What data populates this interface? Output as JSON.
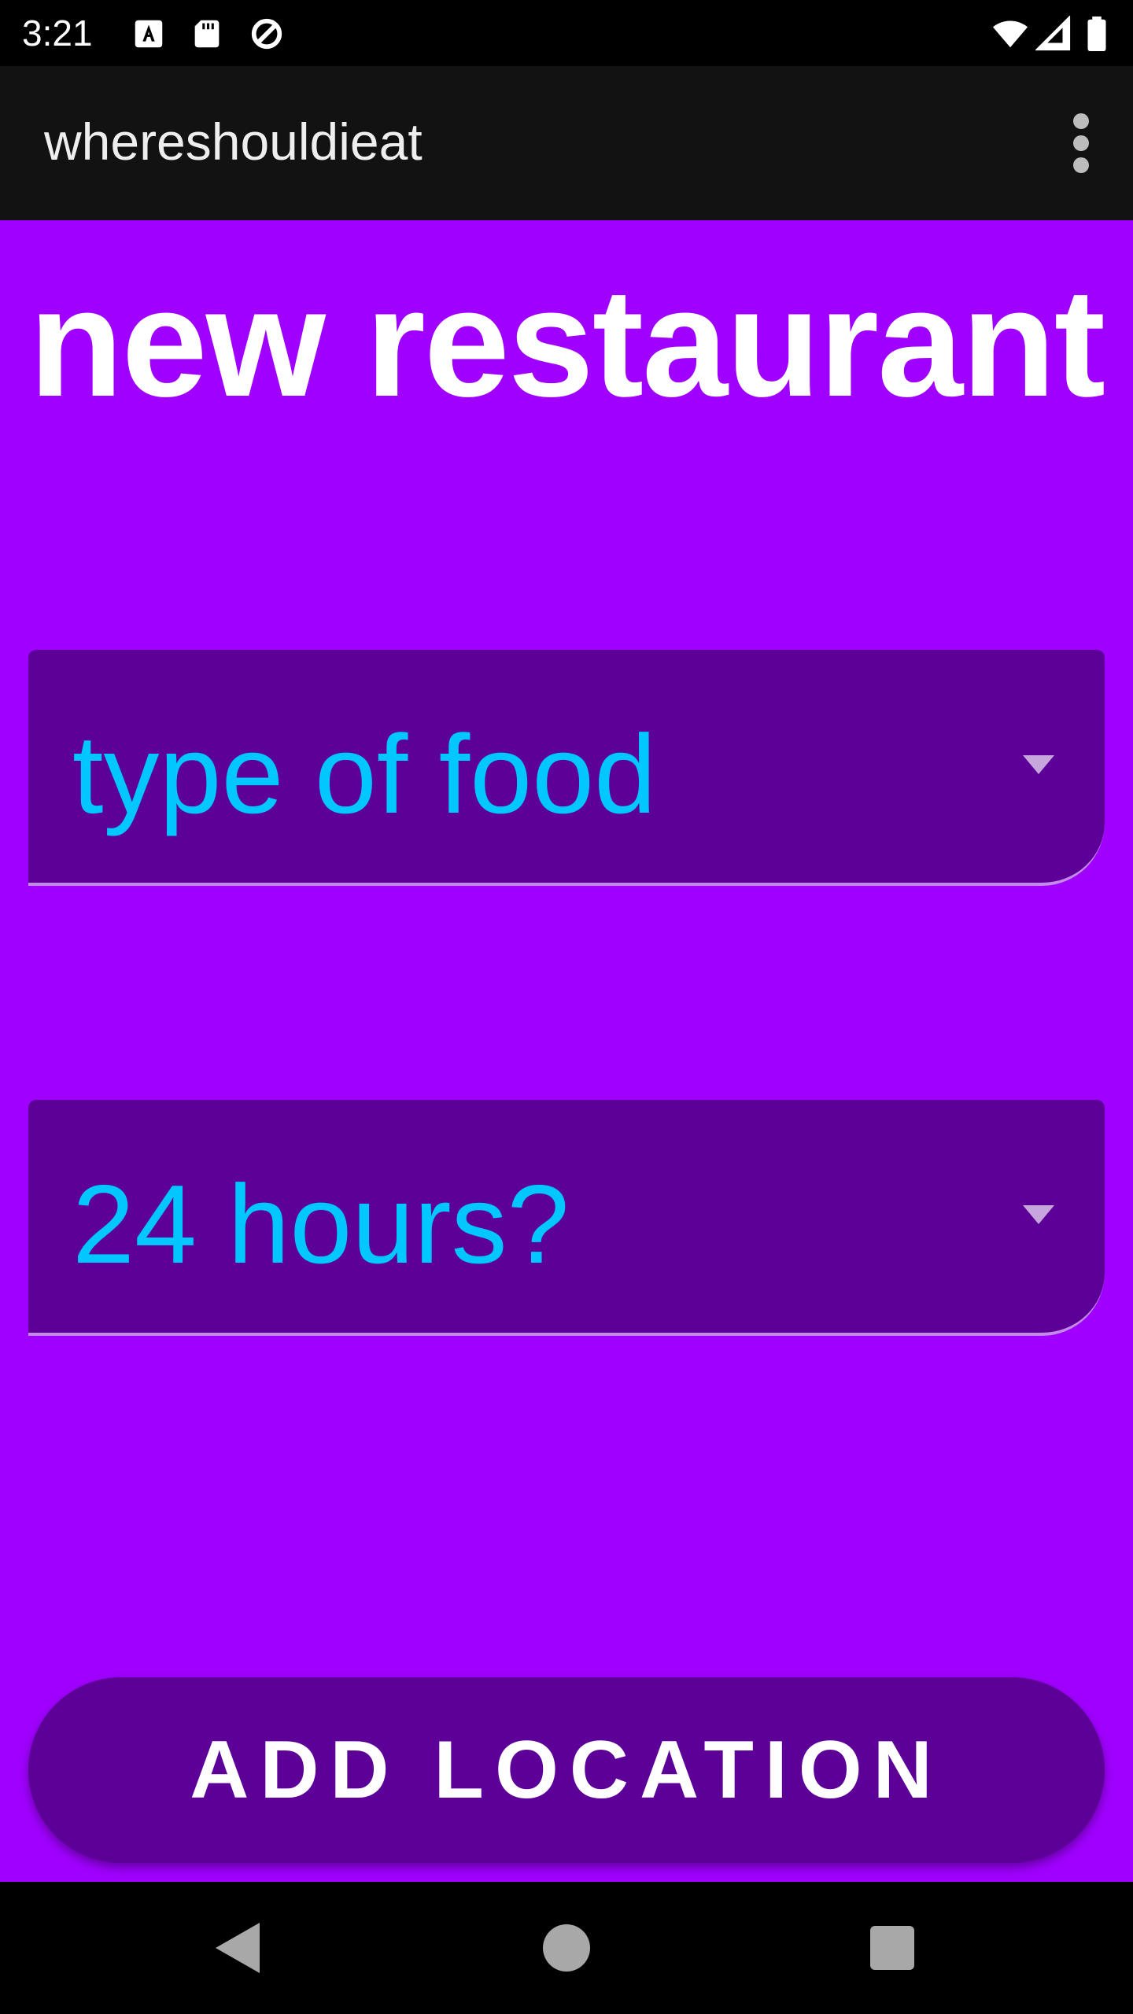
{
  "status_bar": {
    "time": "3:21",
    "icons": [
      "accessibility-a-icon",
      "sd-card-icon",
      "data-saver-icon",
      "wifi-icon",
      "cell-signal-icon",
      "battery-icon"
    ]
  },
  "app_bar": {
    "title": "whereshouldieat",
    "menu_icon": "more-vert-icon"
  },
  "main": {
    "heading": "new restaurant",
    "food_type_spinner": {
      "selected": "type of food"
    },
    "hours_spinner": {
      "selected": "24 hours?"
    },
    "add_button_label": "ADD LOCATION"
  },
  "nav_bar": {
    "buttons": [
      "back-icon",
      "home-icon",
      "recents-icon"
    ]
  },
  "colors": {
    "background": "#a000ff",
    "surface": "#5c0098",
    "spinner_text": "#00c8ff",
    "app_bar": "#121212"
  }
}
